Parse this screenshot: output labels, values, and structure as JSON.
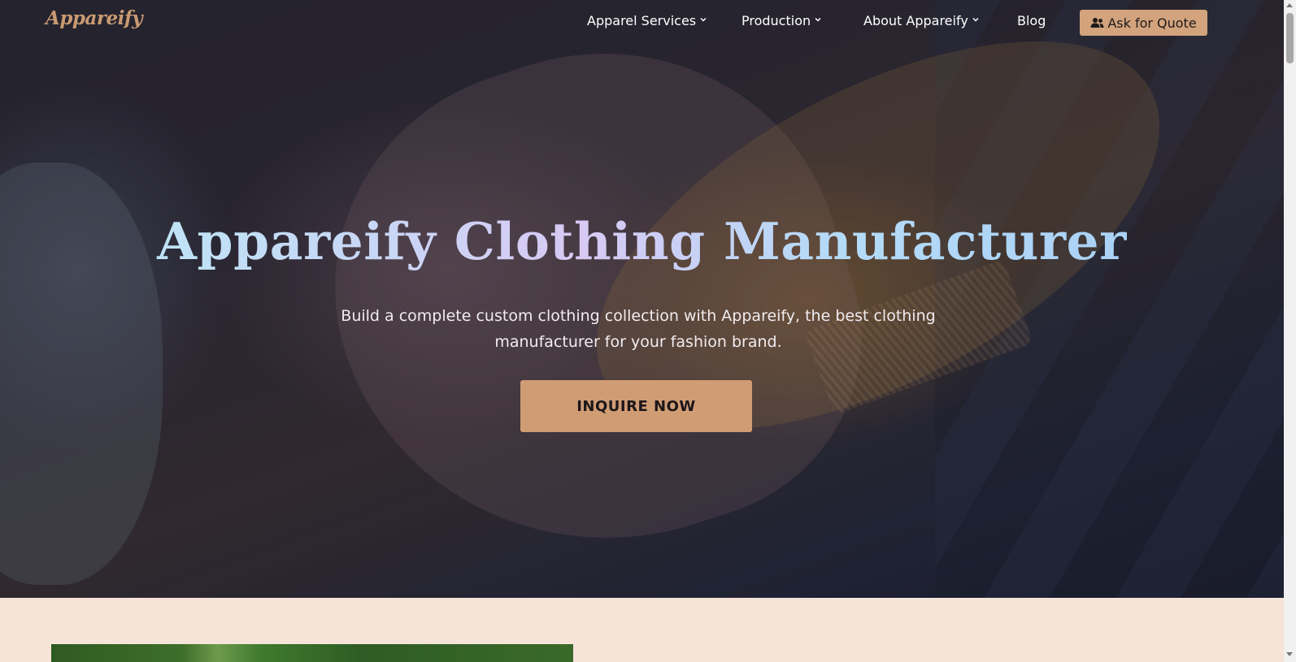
{
  "nav": {
    "logo": "Appareify",
    "items": [
      {
        "label": "Apparel Services",
        "has_dropdown": true
      },
      {
        "label": "Production",
        "has_dropdown": true
      },
      {
        "label": "About Appareify",
        "has_dropdown": true
      },
      {
        "label": "Blog",
        "has_dropdown": false
      }
    ],
    "quote_button": {
      "label": "Ask for Quote",
      "icon": "users-icon"
    }
  },
  "hero": {
    "title": "Appareify Clothing Manufacturer",
    "subtitle": "Build a complete custom clothing collection with Appareify, the best clothing manufacturer for your fashion brand.",
    "cta_label": "INQUIRE NOW"
  },
  "colors": {
    "accent": "#d2a37c",
    "logo": "#c99a72",
    "section_bg": "#f6e4d9"
  }
}
